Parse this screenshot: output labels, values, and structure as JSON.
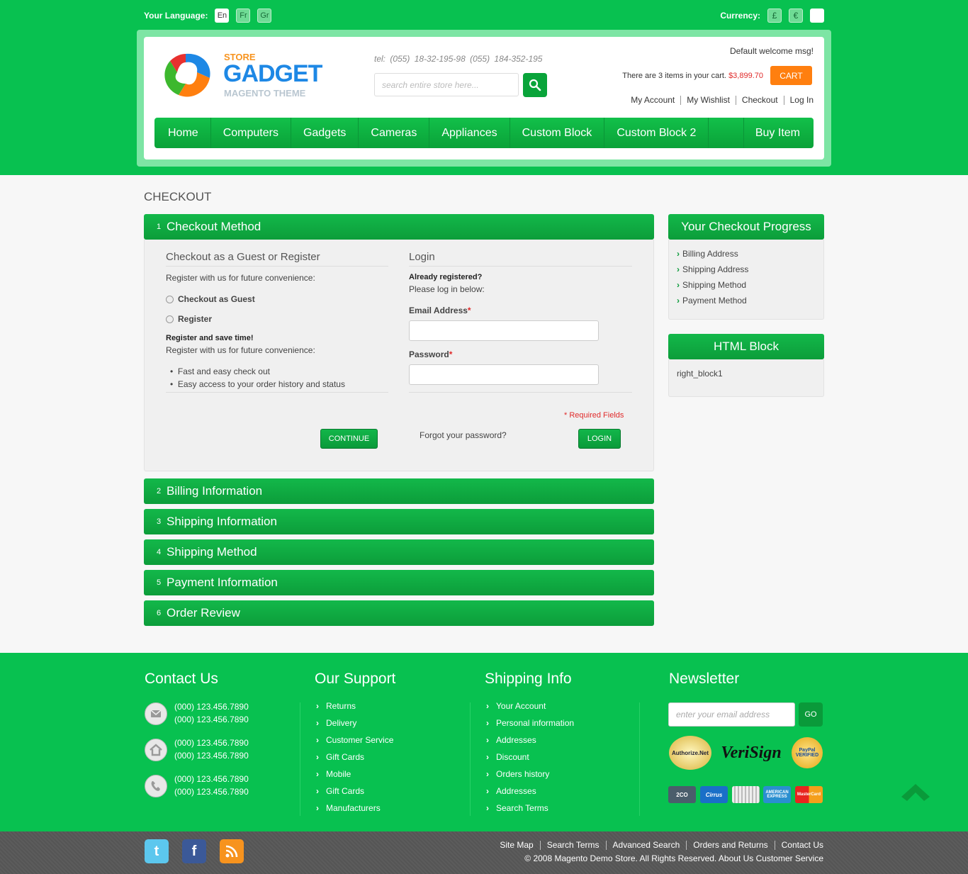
{
  "topbar": {
    "language_label": "Your Language:",
    "languages": [
      "En",
      "Fr",
      "Gr"
    ],
    "currency_label": "Currency:",
    "currencies": [
      "£",
      "€",
      ""
    ]
  },
  "header": {
    "logo_store": "STORE",
    "logo_name": "GADGET",
    "logo_sub": "MAGENTO THEME",
    "tel": "tel:  (055) 18-32-195-98  (055) 184-352-195",
    "search_placeholder": "search entire store here...",
    "welcome": "Default welcome msg!",
    "cart_prefix": "There are 3 items in your cart.",
    "cart_price": "$3,899.70",
    "cart_button": "CART",
    "account_links": [
      "My Account",
      "My Wishlist",
      "Checkout",
      "Log In"
    ]
  },
  "nav": {
    "items": [
      "Home",
      "Computers",
      "Gadgets",
      "Cameras",
      "Appliances",
      "Custom Block",
      "Custom Block 2"
    ],
    "buy": "Buy Item"
  },
  "page_title": "CHECKOUT",
  "steps": [
    {
      "num": "1",
      "title": "Checkout Method"
    },
    {
      "num": "2",
      "title": "Billing Information"
    },
    {
      "num": "3",
      "title": "Shipping Information"
    },
    {
      "num": "4",
      "title": "Shipping Method"
    },
    {
      "num": "5",
      "title": "Payment Information"
    },
    {
      "num": "6",
      "title": "Order Review"
    }
  ],
  "guest": {
    "title": "Checkout as a Guest or Register",
    "intro": "Register with us for future convenience:",
    "option_guest": "Checkout as Guest",
    "option_register": "Register",
    "save_title": "Register and save time!",
    "save_intro": "Register with us for future convenience:",
    "benefits": [
      "Fast and easy check out",
      "Easy access to your order history and status"
    ],
    "continue": "CONTINUE"
  },
  "login": {
    "title": "Login",
    "already": "Already registered?",
    "please": "Please log in below:",
    "email_label": "Email Address",
    "password_label": "Password",
    "required_star": "*",
    "required_note": "* Required Fields",
    "forgot": "Forgot your password?",
    "login_button": "LOGIN"
  },
  "sidebar": {
    "progress_title": "Your Checkout Progress",
    "progress_items": [
      "Billing Address",
      "Shipping Address",
      "Shipping Method",
      "Payment Method"
    ],
    "html_block_title": "HTML Block",
    "html_block_text": "right_block1"
  },
  "footer": {
    "contact_title": "Contact Us",
    "contacts": [
      [
        "(000) 123.456.7890",
        "(000) 123.456.7890"
      ],
      [
        "(000) 123.456.7890",
        "(000) 123.456.7890"
      ],
      [
        "(000) 123.456.7890",
        "(000) 123.456.7890"
      ]
    ],
    "support_title": "Our Support",
    "support_links": [
      "Returns",
      "Delivery",
      "Customer Service",
      "Gift Cards",
      "Mobile",
      "Gift Cards",
      "Manufacturers"
    ],
    "shipping_title": "Shipping Info",
    "shipping_links": [
      "Your Account",
      "Personal information",
      "Addresses",
      "Discount",
      "Orders history",
      "Addresses",
      "Search Terms"
    ],
    "newsletter_title": "Newsletter",
    "newsletter_placeholder": "enter your email address",
    "newsletter_button": "GO",
    "trust_badges": [
      "Authorize.Net",
      "VeriSign",
      "PayPal VERIFIED"
    ],
    "cards": [
      "2CO",
      "Cirrus",
      "",
      "AMERICAN EXPRESS",
      "MasterCard"
    ]
  },
  "bottom": {
    "links": [
      "Site Map",
      "Search Terms",
      "Advanced Search",
      "Orders and Returns",
      "Contact Us"
    ],
    "copyright": "© 2008 Magento Demo Store. All Rights Reserved.  About Us  Customer Service"
  },
  "colors": {
    "brand_green": "#08c150",
    "button_green": "#0a9a3a",
    "cart_orange": "#ff7f0f",
    "price_red": "#e02a2a"
  }
}
